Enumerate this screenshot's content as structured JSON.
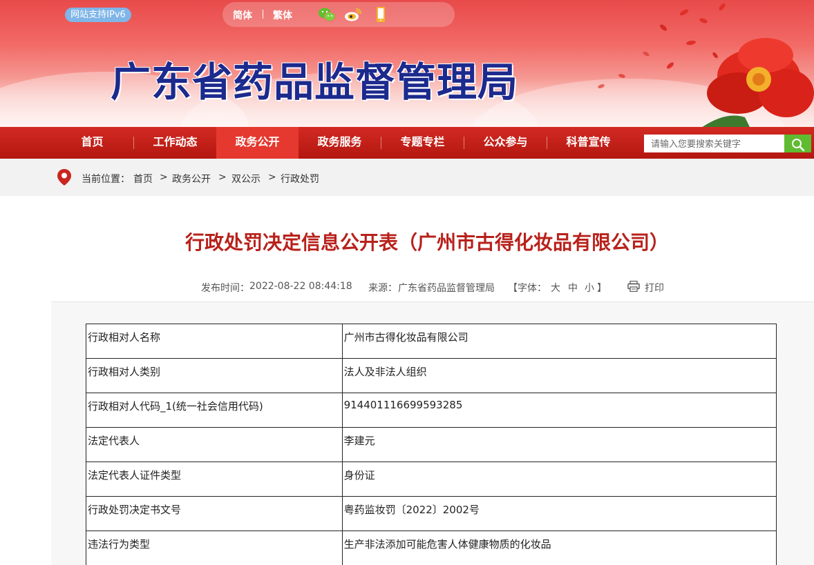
{
  "header": {
    "ipv6_badge": "网站支持IPv6",
    "lang_simplified": "简体",
    "lang_traditional": "繁体",
    "site_title": "广东省药品监督管理局",
    "icons": [
      "wechat-icon",
      "weibo-icon",
      "mobile-icon"
    ]
  },
  "nav": {
    "items": [
      {
        "label": "首页"
      },
      {
        "label": "工作动态"
      },
      {
        "label": "政务公开"
      },
      {
        "label": "政务服务"
      },
      {
        "label": "专题专栏"
      },
      {
        "label": "公众参与"
      },
      {
        "label": "科普宣传"
      }
    ],
    "active": "政务公开",
    "search_placeholder": "请输入您要搜索关键字"
  },
  "breadcrumb": {
    "prefix": "当前位置：",
    "items": [
      "首页",
      "政务公开",
      "双公示",
      "行政处罚"
    ],
    "separator": ">"
  },
  "article": {
    "title": "行政处罚决定信息公开表（广州市古得化妆品有限公司）",
    "publish_label": "发布时间：",
    "publish_time": "2022-08-22 08:44:18",
    "source_label": "来源：",
    "source": "广东省药品监督管理局",
    "font_label": "【字体：",
    "font_large": "大",
    "font_medium": "中",
    "font_small": "小",
    "font_close": "】",
    "print_label": "打印"
  },
  "table": {
    "rows": [
      {
        "key": "行政相对人名称",
        "value": "广州市古得化妆品有限公司"
      },
      {
        "key": "行政相对人类别",
        "value": "法人及非法人组织"
      },
      {
        "key": "行政相对人代码_1(统一社会信用代码)",
        "value": "914401116699593285"
      },
      {
        "key": "法定代表人",
        "value": "李建元"
      },
      {
        "key": "法定代表人证件类型",
        "value": "身份证"
      },
      {
        "key": "行政处罚决定书文号",
        "value": "粤药监妆罚〔2022〕2002号"
      },
      {
        "key": "违法行为类型",
        "value": "生产非法添加可能危害人体健康物质的化妆品"
      }
    ]
  },
  "colors": {
    "nav_bg": "#c1201a",
    "nav_active": "#e5392f",
    "title_red": "#b8211b",
    "site_title_blue": "#1c2a8e",
    "search_green": "#5fbb2f",
    "ipv6_blue": "#7fb5e8"
  }
}
